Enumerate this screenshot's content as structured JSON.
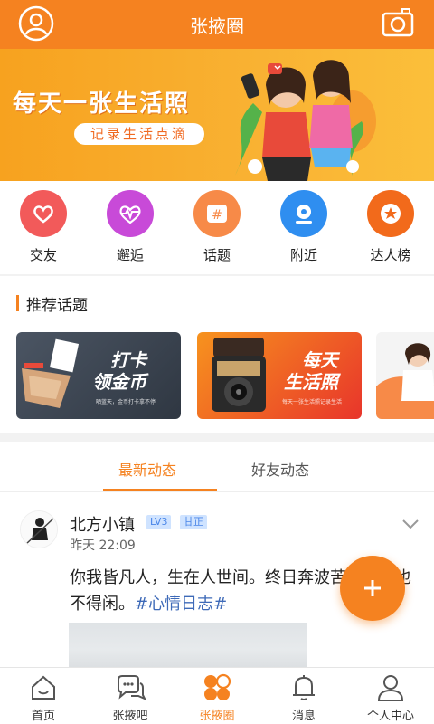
{
  "header": {
    "title": "张掖圈",
    "colors": {
      "accent": "#f58220"
    }
  },
  "banner": {
    "headline": "每天一张生活照",
    "tagline": "记录生活点滴"
  },
  "categories": [
    {
      "label": "交友",
      "icon": "heart-icon",
      "color": "#f25a5a"
    },
    {
      "label": "邂逅",
      "icon": "heartbeat-icon",
      "color": "#c84ad8"
    },
    {
      "label": "话题",
      "icon": "hashtag-icon",
      "color": "#f78a48"
    },
    {
      "label": "附近",
      "icon": "location-icon",
      "color": "#2f8ef0"
    },
    {
      "label": "达人榜",
      "icon": "star-badge-icon",
      "color": "#f26a1b"
    }
  ],
  "recommended": {
    "title": "推荐话题",
    "cards": [
      {
        "title_line1": "打卡",
        "title_line2": "领金币",
        "subtitle": "晒蓝天，金币打卡拿不停"
      },
      {
        "title_line1": "每天",
        "title_line2": "生活照",
        "subtitle": "每天一张生活照记录生活"
      }
    ]
  },
  "tabs": [
    {
      "label": "最新动态"
    },
    {
      "label": "好友动态"
    }
  ],
  "post": {
    "username": "北方小镇",
    "level": "LV3",
    "location": "甘正",
    "time": "昨天 22:09",
    "body": "你我皆凡人，生在人世间。终日奔波苦，一刻也不得闲。",
    "tag": "#心情日志#"
  },
  "bottom_nav": [
    {
      "label": "首页",
      "icon": "home-icon"
    },
    {
      "label": "张掖吧",
      "icon": "chat-bubbles-icon"
    },
    {
      "label": "张掖圈",
      "icon": "clover-icon",
      "active": true
    },
    {
      "label": "消息",
      "icon": "bell-icon"
    },
    {
      "label": "个人中心",
      "icon": "person-icon"
    }
  ]
}
